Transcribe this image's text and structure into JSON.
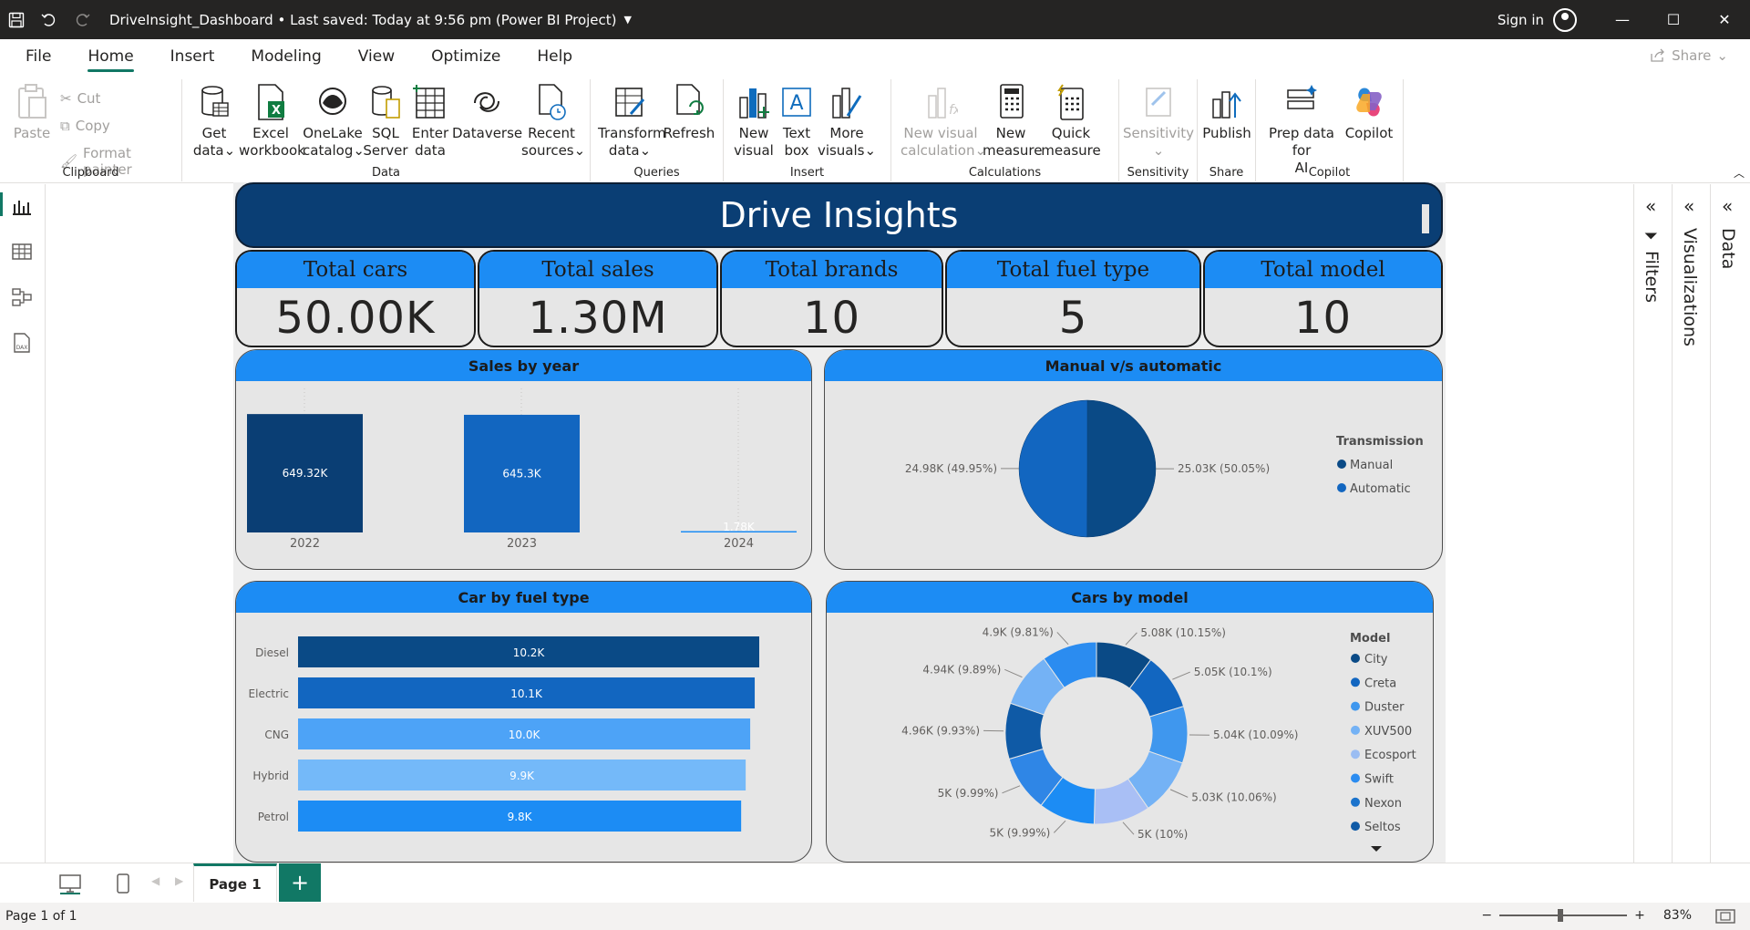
{
  "titlebar": {
    "title": "DriveInsight_Dashboard • Last saved: Today at 9:56 pm (Power BI Project)",
    "sign_in": "Sign in"
  },
  "menu": {
    "tabs": [
      "File",
      "Home",
      "Insert",
      "Modeling",
      "View",
      "Optimize",
      "Help"
    ],
    "active": "Home",
    "share": "Share"
  },
  "ribbon": {
    "clipboard": {
      "paste": "Paste",
      "cut": "Cut",
      "copy": "Copy",
      "format_painter": "Format painter",
      "label": "Clipboard"
    },
    "data": {
      "get_data": [
        "Get",
        "data"
      ],
      "excel": [
        "Excel",
        "workbook"
      ],
      "onelake": [
        "OneLake",
        "catalog"
      ],
      "sql": [
        "SQL",
        "Server"
      ],
      "enter": [
        "Enter",
        "data"
      ],
      "dataverse": "Dataverse",
      "recent": [
        "Recent",
        "sources"
      ],
      "label": "Data"
    },
    "queries": {
      "transform": [
        "Transform",
        "data"
      ],
      "refresh": "Refresh",
      "label": "Queries"
    },
    "insert": {
      "new_visual": [
        "New",
        "visual"
      ],
      "text_box": [
        "Text",
        "box"
      ],
      "more_visuals": [
        "More",
        "visuals"
      ],
      "label": "Insert"
    },
    "calculations": {
      "new_visual_calc": [
        "New visual",
        "calculation"
      ],
      "new_measure": [
        "New",
        "measure"
      ],
      "quick_measure": [
        "Quick",
        "measure"
      ],
      "label": "Calculations"
    },
    "sensitivity": {
      "btn": "Sensitivity",
      "label": "Sensitivity"
    },
    "share": {
      "publish": "Publish",
      "label": "Share"
    },
    "copilot": {
      "prep": [
        "Prep data for",
        "AI"
      ],
      "copilot": "Copilot",
      "label": "Copilot"
    }
  },
  "report": {
    "title": "Drive Insights",
    "kpis": [
      {
        "label": "Total cars",
        "value": "50.00K"
      },
      {
        "label": "Total sales",
        "value": "1.30M"
      },
      {
        "label": "Total brands",
        "value": "10"
      },
      {
        "label": "Total fuel type",
        "value": "5"
      },
      {
        "label": "Total model",
        "value": "10"
      }
    ],
    "sales_title": "Sales by year",
    "trans_title": "Manual v/s automatic",
    "fuel_title": "Car by fuel type",
    "model_title": "Cars by model"
  },
  "chart_data": [
    {
      "type": "bar",
      "title": "Sales by year",
      "categories": [
        "2022",
        "2023",
        "2024"
      ],
      "values": [
        649320,
        645300,
        1780
      ],
      "labels": [
        "649.32K",
        "645.3K",
        "1.78K"
      ],
      "color": "#0a3e74"
    },
    {
      "type": "pie",
      "title": "Manual v/s automatic",
      "legend_title": "Transmission",
      "series": [
        {
          "name": "Manual",
          "value": 25030,
          "label": "25.03K (50.05%)",
          "color": "#0a4a86"
        },
        {
          "name": "Automatic",
          "value": 24980,
          "label": "24.98K (49.95%)",
          "color": "#1266c0"
        }
      ]
    },
    {
      "type": "bar",
      "orientation": "horizontal",
      "title": "Car by fuel type",
      "categories": [
        "Diesel",
        "Electric",
        "CNG",
        "Hybrid",
        "Petrol"
      ],
      "values": [
        10200,
        10100,
        10000,
        9900,
        9800
      ],
      "labels": [
        "10.2K",
        "10.1K",
        "10.0K",
        "9.9K",
        "9.8K"
      ],
      "colors": [
        "#0a4a86",
        "#1266c0",
        "#4da3f7",
        "#74b9f9",
        "#1c8cf4"
      ]
    },
    {
      "type": "pie",
      "subtype": "donut",
      "title": "Cars by model",
      "legend_title": "Model",
      "legend": [
        "City",
        "Creta",
        "Duster",
        "XUV500",
        "Ecosport",
        "Swift",
        "Nexon",
        "Seltos"
      ],
      "legend_colors": [
        "#0a4a86",
        "#1266c0",
        "#3f97ee",
        "#74b2f5",
        "#9bbdf2",
        "#2b8cf0",
        "#1b73cc",
        "#0f5aa6"
      ],
      "slices": [
        {
          "value": 5080,
          "label": "5.08K (10.15%)",
          "color": "#0a4a86"
        },
        {
          "value": 5050,
          "label": "5.05K (10.1%)",
          "color": "#1266c0"
        },
        {
          "value": 5040,
          "label": "5.04K (10.09%)",
          "color": "#3f97ee"
        },
        {
          "value": 5030,
          "label": "5.03K (10.06%)",
          "color": "#74b2f5"
        },
        {
          "value": 5000,
          "label": "5K (10%)",
          "color": "#a9bff5"
        },
        {
          "value": 5000,
          "label": "5K (9.99%)",
          "color": "#1c8cf4"
        },
        {
          "value": 4990,
          "label": "5K (9.99%)",
          "color": "#2f86e6"
        },
        {
          "value": 4960,
          "label": "4.96K (9.93%)",
          "color": "#0f5aa6"
        },
        {
          "value": 4940,
          "label": "4.94K (9.89%)",
          "color": "#74b2f5"
        },
        {
          "value": 4900,
          "label": "4.9K (9.81%)",
          "color": "#2b8cf0"
        }
      ]
    }
  ],
  "panes": {
    "filters": "Filters",
    "visualizations": "Visualizations",
    "data": "Data"
  },
  "pages": {
    "tab": "Page 1"
  },
  "status": {
    "page": "Page 1 of 1",
    "zoom": "83%"
  }
}
